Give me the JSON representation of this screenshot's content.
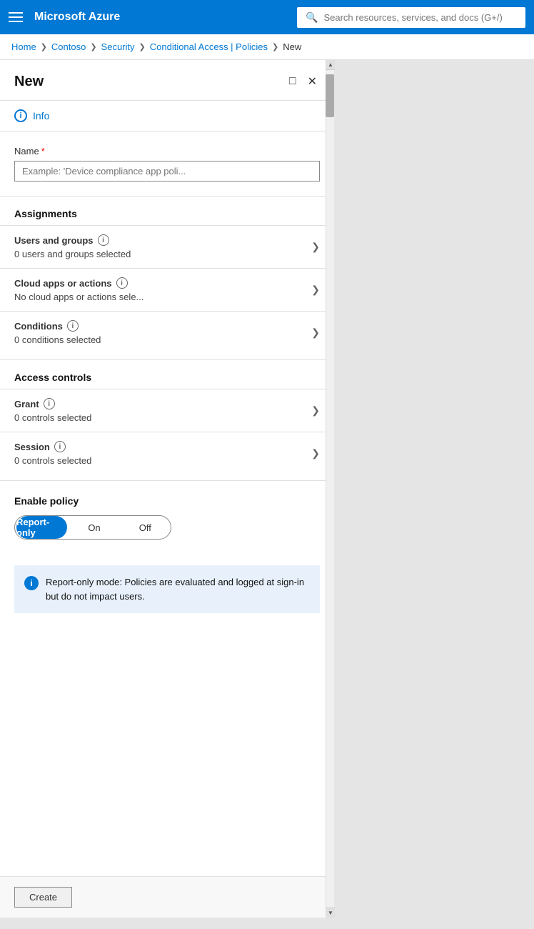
{
  "topbar": {
    "title": "Microsoft Azure",
    "search_placeholder": "Search resources, services, and docs (G+/)"
  },
  "breadcrumb": {
    "items": [
      "Home",
      "Contoso",
      "Security",
      "Conditional Access | Policies",
      "New"
    ]
  },
  "panel": {
    "title": "New",
    "info_label": "Info",
    "name_label": "Name",
    "name_placeholder": "Example: 'Device compliance app poli...",
    "assignments_heading": "Assignments",
    "access_controls_heading": "Access controls",
    "enable_policy_heading": "Enable policy",
    "assignments": [
      {
        "title": "Users and groups",
        "subtitle": "0 users and groups selected"
      },
      {
        "title": "Cloud apps or actions",
        "subtitle": "No cloud apps or actions sele..."
      },
      {
        "title": "Conditions",
        "subtitle": "0 conditions selected"
      }
    ],
    "controls": [
      {
        "title": "Grant",
        "subtitle": "0 controls selected"
      },
      {
        "title": "Session",
        "subtitle": "0 controls selected"
      }
    ],
    "toggle_options": [
      "Report-only",
      "On",
      "Off"
    ],
    "active_toggle": "Report-only",
    "info_box_text": "Report-only mode: Policies are evaluated and logged at sign-in but do not impact users.",
    "create_btn": "Create"
  }
}
